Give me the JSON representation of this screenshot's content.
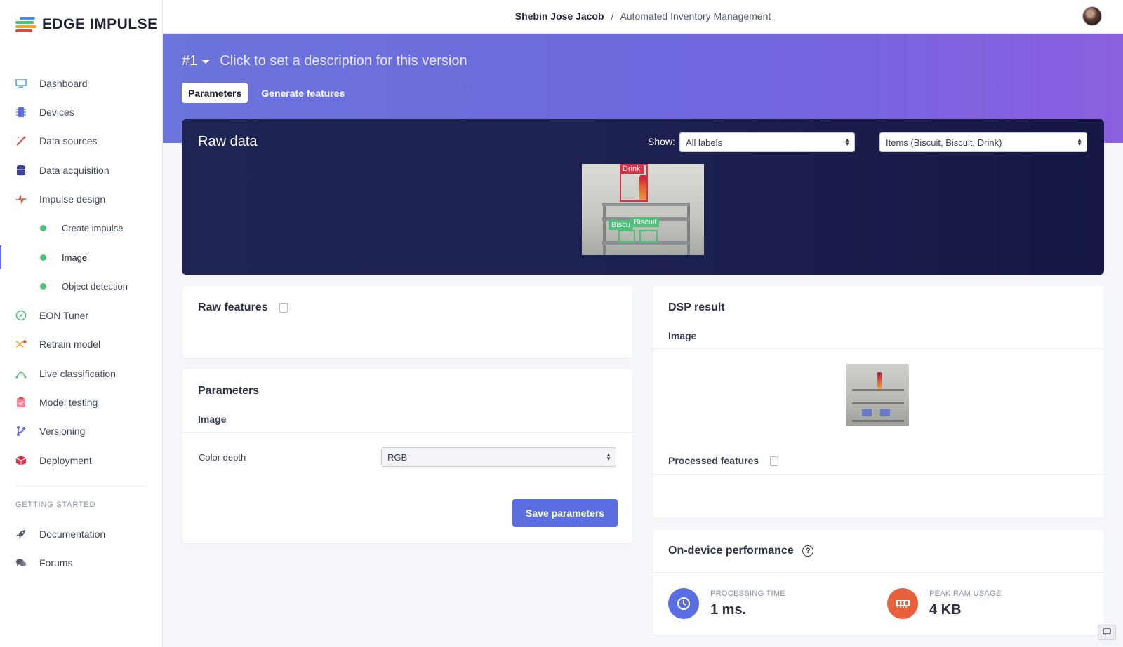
{
  "brand": {
    "name": "EDGE IMPULSE",
    "colors": [
      "#e8453c",
      "#f5a623",
      "#4ec07a",
      "#4a90e2"
    ]
  },
  "sidebar": {
    "items": [
      {
        "label": "Dashboard",
        "icon": "monitor-icon",
        "color": "#4aa3df"
      },
      {
        "label": "Devices",
        "icon": "chip-icon",
        "color": "#5b6ee1"
      },
      {
        "label": "Data sources",
        "icon": "wand-icon",
        "color": "#e8453c"
      },
      {
        "label": "Data acquisition",
        "icon": "database-icon",
        "color": "#3b3f9e"
      },
      {
        "label": "Impulse design",
        "icon": "pulse-icon",
        "color": "#e8453c"
      }
    ],
    "sub_items": [
      {
        "label": "Create impulse"
      },
      {
        "label": "Image"
      },
      {
        "label": "Object detection"
      }
    ],
    "items2": [
      {
        "label": "EON Tuner",
        "icon": "compass-icon",
        "color": "#4ec07a"
      },
      {
        "label": "Retrain model",
        "icon": "shuffle-icon",
        "color": "#f5a623"
      },
      {
        "label": "Live classification",
        "icon": "signal-icon",
        "color": "#4ec07a"
      },
      {
        "label": "Model testing",
        "icon": "clipboard-icon",
        "color": "#e8453c"
      },
      {
        "label": "Versioning",
        "icon": "branch-icon",
        "color": "#5b6ee1"
      },
      {
        "label": "Deployment",
        "icon": "box-icon",
        "color": "#d6334a"
      }
    ],
    "section_heading": "GETTING STARTED",
    "getting_started": [
      {
        "label": "Documentation",
        "icon": "rocket-icon",
        "color": "#555b6e"
      },
      {
        "label": "Forums",
        "icon": "chat-icon",
        "color": "#555b6e"
      }
    ]
  },
  "header": {
    "owner": "Shebin Jose Jacob",
    "separator": "/",
    "project": "Automated Inventory Management"
  },
  "version": {
    "number": "#1",
    "description_placeholder": "Click to set a description for this version"
  },
  "tabs": [
    {
      "label": "Parameters"
    },
    {
      "label": "Generate features"
    }
  ],
  "raw_data": {
    "title": "Raw data",
    "show_label": "Show:",
    "label_filter": "All labels",
    "sample_select": "Items (Biscuit, Biscuit, Drink)",
    "boxes": [
      {
        "label": "Drink"
      },
      {
        "label": "Biscu"
      },
      {
        "label": "Biscuit"
      }
    ]
  },
  "raw_features": {
    "title": "Raw features"
  },
  "parameters": {
    "title": "Parameters",
    "subhead": "Image",
    "color_depth_label": "Color depth",
    "color_depth_value": "RGB",
    "save_button": "Save parameters"
  },
  "dsp_result": {
    "title": "DSP result",
    "subhead": "Image",
    "processed_features": "Processed features"
  },
  "performance": {
    "title": "On-device performance",
    "help": "?",
    "processing_label": "PROCESSING TIME",
    "processing_value": "1 ms.",
    "ram_label": "PEAK RAM USAGE",
    "ram_value": "4 KB"
  }
}
